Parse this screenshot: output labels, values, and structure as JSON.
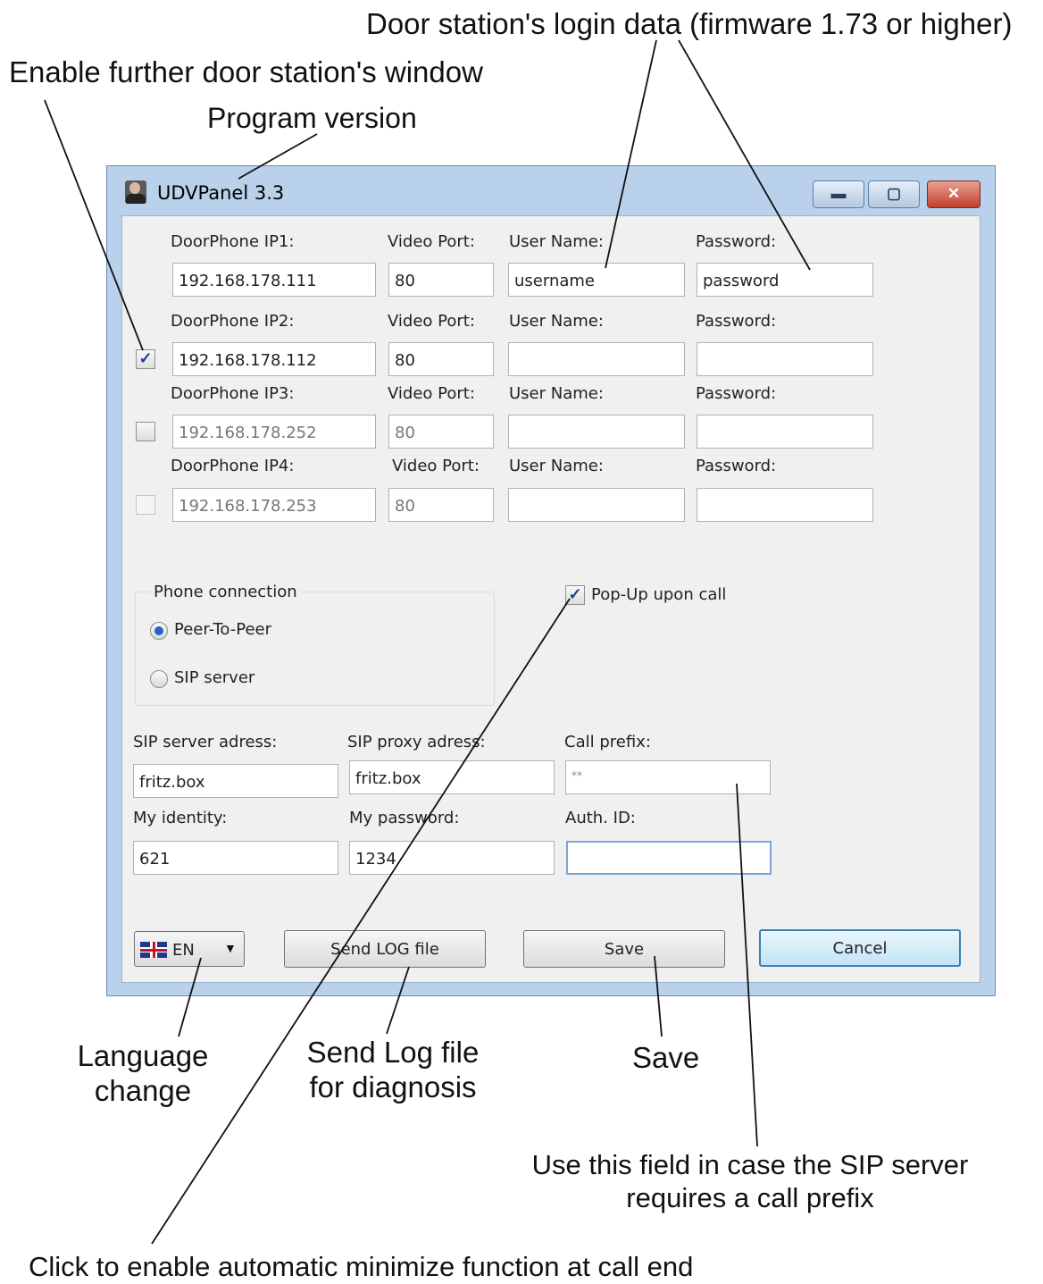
{
  "annotations": {
    "login_data": "Door station's login data (firmware 1.73 or higher)",
    "enable_window": "Enable further door station's window",
    "program_version": "Program version",
    "language_1": "Language",
    "language_2": "change",
    "sendlog_1": "Send Log file",
    "sendlog_2": "for diagnosis",
    "save": "Save",
    "prefix_1": "Use this field in case the SIP server",
    "prefix_2": "requires a call prefix",
    "minimize": "Click to enable automatic minimize function at call end"
  },
  "window": {
    "title": "UDVPanel 3.3",
    "min_icon": "minimize-icon",
    "max_icon": "maximize-icon",
    "close_icon": "close-icon"
  },
  "doorphones": [
    {
      "ip_label": "DoorPhone IP1:",
      "port_label": "Video Port:",
      "user_label": "User Name:",
      "pass_label": "Password:",
      "ip": "192.168.178.111",
      "port": "80",
      "user": "username",
      "pass": "password",
      "checked": null
    },
    {
      "ip_label": "DoorPhone IP2:",
      "port_label": "Video Port:",
      "user_label": "User Name:",
      "pass_label": "Password:",
      "ip": "192.168.178.112",
      "port": "80",
      "user": "",
      "pass": "",
      "checked": true
    },
    {
      "ip_label": "DoorPhone IP3:",
      "port_label": "Video Port:",
      "user_label": "User Name:",
      "pass_label": "Password:",
      "ip": "192.168.178.252",
      "port": "80",
      "user": "",
      "pass": "",
      "checked": false
    },
    {
      "ip_label": "DoorPhone IP4:",
      "port_label": "Video Port:",
      "user_label": "User Name:",
      "pass_label": "Password:",
      "ip": "192.168.178.253",
      "port": "80",
      "user": "",
      "pass": "",
      "checked": false
    }
  ],
  "phone_connection": {
    "title": "Phone connection",
    "option_p2p": "Peer-To-Peer",
    "option_sip": "SIP server",
    "selected": "Peer-To-Peer"
  },
  "popup": {
    "label": "Pop-Up upon call",
    "checked": true,
    "check_mark": "✓"
  },
  "sip": {
    "server_label": "SIP server adress:",
    "server": "fritz.box",
    "proxy_label": "SIP proxy adress:",
    "proxy": "fritz.box",
    "prefix_label": "Call prefix:",
    "prefix": "**",
    "identity_label": "My identity:",
    "identity": "621",
    "password_label": "My password:",
    "password": "1234",
    "auth_label": "Auth. ID:",
    "auth": ""
  },
  "buttons": {
    "language": "EN",
    "language_icon": "uk-flag-icon",
    "send_log": "Send LOG file",
    "save": "Save",
    "cancel": "Cancel"
  },
  "colors": {
    "window_frame": "#b9d1ea",
    "client_bg": "#f0f0f0",
    "close_button": "#c2402c",
    "default_button_border": "#3c7fb1"
  }
}
